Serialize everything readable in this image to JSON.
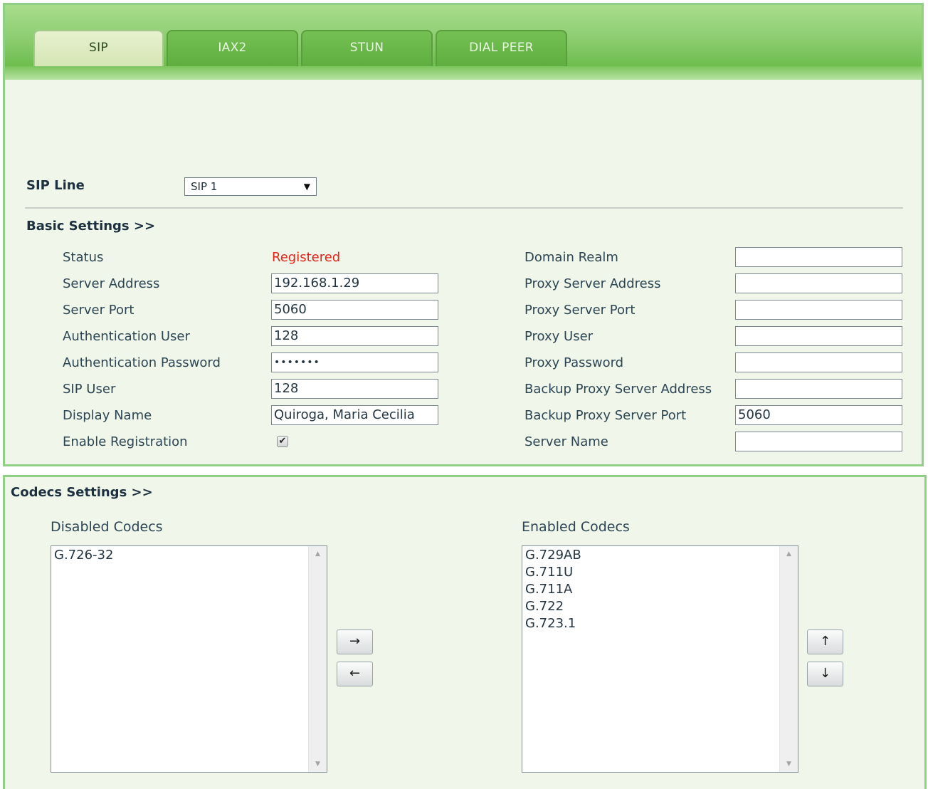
{
  "tabs": [
    {
      "label": "SIP",
      "active": true
    },
    {
      "label": "IAX2",
      "active": false
    },
    {
      "label": "STUN",
      "active": false
    },
    {
      "label": "DIAL PEER",
      "active": false
    }
  ],
  "sip_line": {
    "label": "SIP Line",
    "selected": "SIP 1"
  },
  "basic": {
    "heading": "Basic Settings >>",
    "status_label": "Status",
    "status_value": "Registered",
    "status_color": "#e2231a",
    "server_address_label": "Server Address",
    "server_address_value": "192.168.1.29",
    "server_port_label": "Server Port",
    "server_port_value": "5060",
    "auth_user_label": "Authentication User",
    "auth_user_value": "128",
    "auth_password_label": "Authentication Password",
    "auth_password_value": "•••••••",
    "sip_user_label": "SIP User",
    "sip_user_value": "128",
    "display_name_label": "Display Name",
    "display_name_value": "Quiroga, Maria Cecilia",
    "enable_registration_label": "Enable Registration",
    "enable_registration_checked": true,
    "domain_realm_label": "Domain Realm",
    "domain_realm_value": "",
    "proxy_server_address_label": "Proxy Server Address",
    "proxy_server_address_value": "",
    "proxy_server_port_label": "Proxy Server Port",
    "proxy_server_port_value": "",
    "proxy_user_label": "Proxy User",
    "proxy_user_value": "",
    "proxy_password_label": "Proxy Password",
    "proxy_password_value": "",
    "backup_proxy_address_label": "Backup Proxy Server Address",
    "backup_proxy_address_value": "",
    "backup_proxy_port_label": "Backup Proxy Server Port",
    "backup_proxy_port_value": "5060",
    "server_name_label": "Server Name",
    "server_name_value": ""
  },
  "codecs": {
    "heading": "Codecs Settings >>",
    "disabled_label": "Disabled Codecs",
    "disabled": [
      "G.726-32"
    ],
    "enabled_label": "Enabled Codecs",
    "enabled": [
      "G.729AB",
      "G.711U",
      "G.711A",
      "G.722",
      "G.723.1"
    ],
    "move_right": "→",
    "move_left": "←",
    "move_up": "↑",
    "move_down": "↓"
  },
  "icons": {
    "select_arrow": "▼",
    "checkbox_check": "✔",
    "scroll_up": "▲",
    "scroll_down": "▼"
  }
}
